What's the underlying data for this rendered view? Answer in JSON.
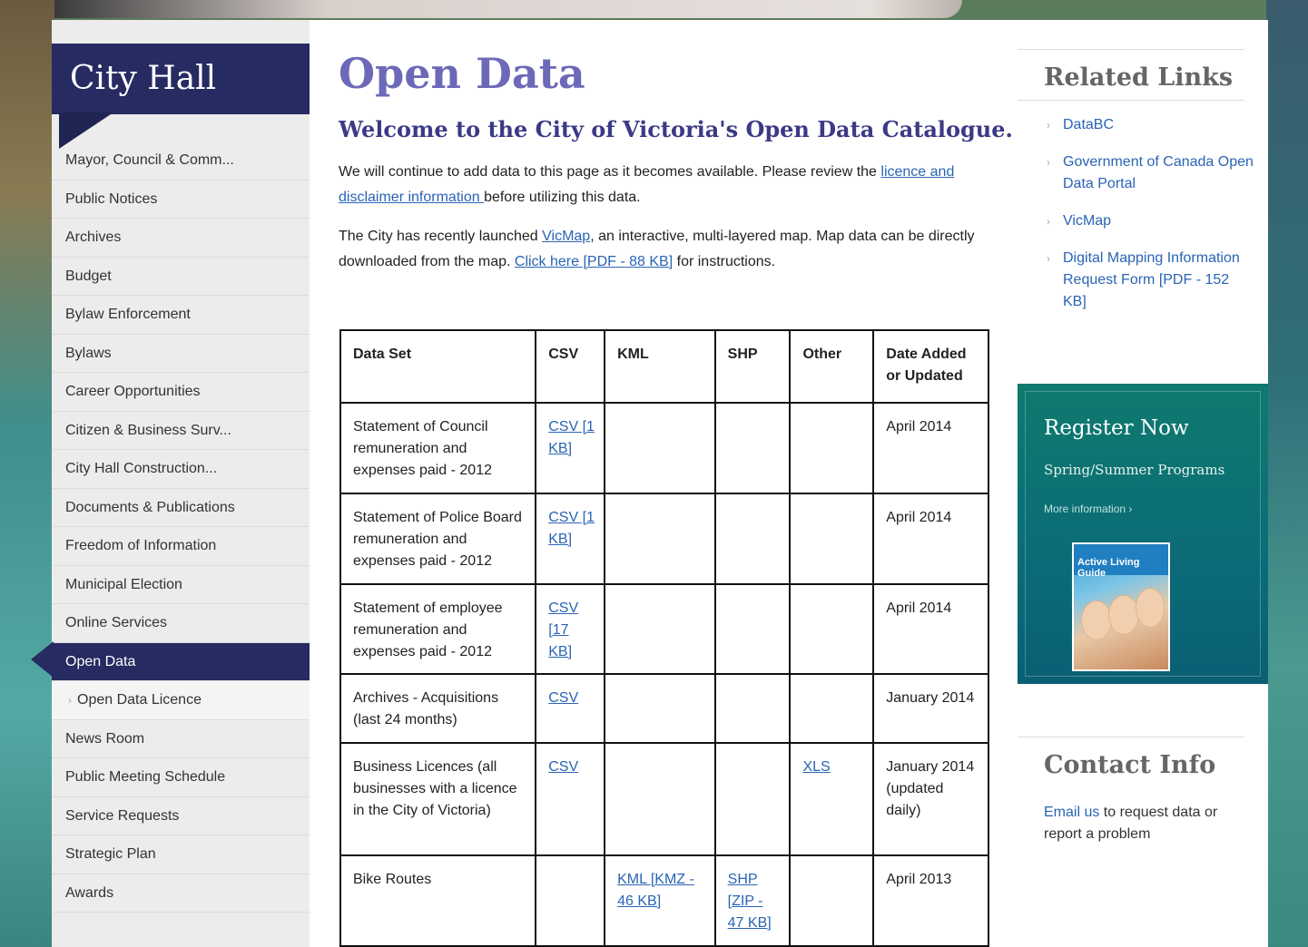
{
  "sidebar": {
    "title": "City Hall",
    "items": [
      {
        "label": "Mayor, Council & Comm...",
        "state": "normal"
      },
      {
        "label": "Public Notices",
        "state": "normal"
      },
      {
        "label": "Archives",
        "state": "normal"
      },
      {
        "label": "Budget",
        "state": "normal"
      },
      {
        "label": "Bylaw Enforcement",
        "state": "normal"
      },
      {
        "label": "Bylaws",
        "state": "normal"
      },
      {
        "label": "Career Opportunities",
        "state": "normal"
      },
      {
        "label": "Citizen & Business Surv...",
        "state": "normal"
      },
      {
        "label": "City Hall Construction...",
        "state": "normal"
      },
      {
        "label": "Documents & Publications",
        "state": "normal"
      },
      {
        "label": "Freedom of Information",
        "state": "normal"
      },
      {
        "label": "Municipal Election",
        "state": "normal"
      },
      {
        "label": "Online Services",
        "state": "normal"
      },
      {
        "label": "Open Data",
        "state": "active"
      },
      {
        "label": "Open Data Licence",
        "state": "sub"
      },
      {
        "label": "News Room",
        "state": "normal"
      },
      {
        "label": "Public Meeting Schedule",
        "state": "normal"
      },
      {
        "label": "Service Requests",
        "state": "normal"
      },
      {
        "label": "Strategic Plan",
        "state": "normal"
      },
      {
        "label": "Awards",
        "state": "normal"
      }
    ]
  },
  "main": {
    "title": "Open Data",
    "subtitle": "Welcome to the City of Victoria's Open Data Catalogue.",
    "p1": {
      "before": "We will continue to add data to this page as it becomes available. Please review the ",
      "link": "licence and disclaimer information ",
      "after": "before utilizing this data."
    },
    "p2": {
      "before": "The City has recently launched ",
      "link1": "VicMap",
      "middle": ", an interactive, multi-layered map. Map data can be directly downloaded from the map. ",
      "link2": "Click here [PDF - 88 KB]",
      "after": " for instructions."
    },
    "table": {
      "headers": [
        "Data Set",
        "CSV",
        "KML",
        "SHP",
        "Other",
        "Date Added or Updated"
      ],
      "rows": [
        {
          "dataset": "Statement of Council remuneration and expenses paid - 2012",
          "csv": "CSV [1 KB]",
          "kml": "",
          "shp": "",
          "other": "",
          "date": "April 2014"
        },
        {
          "dataset": "Statement of Police Board remuneration and expenses paid - 2012",
          "csv": "CSV [1 KB]",
          "kml": "",
          "shp": "",
          "other": "",
          "date": "April 2014"
        },
        {
          "dataset": "Statement of employee remuneration and expenses paid - 2012",
          "csv": "CSV [17 KB]",
          "kml": "",
          "shp": "",
          "other": "",
          "date": "April 2014"
        },
        {
          "dataset": "Archives - Acquisitions (last 24 months)",
          "csv": "CSV",
          "kml": "",
          "shp": "",
          "other": "",
          "date": "January 2014"
        },
        {
          "dataset": "Business Licences (all businesses with a licence in the City of Victoria)",
          "csv": "CSV",
          "kml": "",
          "shp": "",
          "other": "XLS",
          "date": "January 2014 (updated daily)"
        },
        {
          "dataset": "Bike Routes",
          "csv": "",
          "kml": "KML [KMZ - 46 KB]",
          "shp": "SHP [ZIP - 47 KB]",
          "other": "",
          "date": "April 2013"
        }
      ]
    }
  },
  "related": {
    "title": "Related Links",
    "links": [
      "DataBC",
      "Government of Canada Open Data Portal",
      "VicMap",
      "Digital Mapping Information Request Form [PDF - 152 KB]"
    ]
  },
  "register": {
    "title": "Register Now",
    "subtitle": "Spring/Summer Programs",
    "more": "More information ›",
    "guide_label": "Active Living Guide"
  },
  "contact": {
    "title": "Contact Info",
    "link": "Email us",
    "text": " to request data or report a problem"
  },
  "colors": {
    "nav_active": "#262b62",
    "title_purple": "#6c69b8",
    "link_blue": "#2a64b4",
    "register_teal": "#0b6b78"
  }
}
